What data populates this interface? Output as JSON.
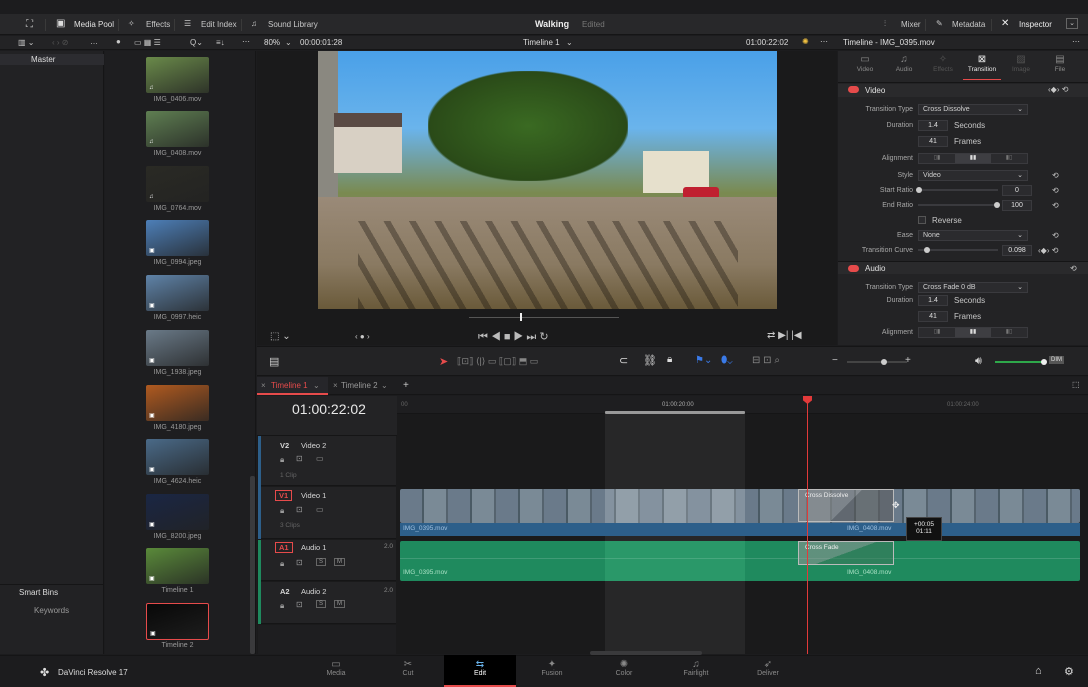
{
  "app": {
    "name": "DaVinci Resolve 17",
    "project": "Walking",
    "project_state": "Edited"
  },
  "toolbar": {
    "media_pool": "Media Pool",
    "effects": "Effects",
    "edit_index": "Edit Index",
    "sound_library": "Sound Library",
    "mixer": "Mixer",
    "metadata": "Metadata",
    "inspector": "Inspector"
  },
  "viewer": {
    "zoom": "80%",
    "source_tc": "00:00:01:28",
    "timeline_name": "Timeline 1",
    "record_tc": "01:00:22:02",
    "clip_title": "Timeline - IMG_0395.mov"
  },
  "bins": {
    "master": "Master",
    "smart_bins": "Smart Bins",
    "keywords": "Keywords"
  },
  "media": [
    {
      "name": "IMG_0406.mov",
      "color": "#6a8a4a"
    },
    {
      "name": "IMG_0408.mov",
      "color": "#5f7f52"
    },
    {
      "name": "IMG_0764.mov",
      "color": "#2a2a24"
    },
    {
      "name": "IMG_0994.jpeg",
      "color": "#4d7fb8"
    },
    {
      "name": "IMG_0997.heic",
      "color": "#5f83a8"
    },
    {
      "name": "IMG_1938.jpeg",
      "color": "#6a7a88"
    },
    {
      "name": "IMG_4180.jpeg",
      "color": "#b05a20"
    },
    {
      "name": "IMG_4624.heic",
      "color": "#4a6a88"
    },
    {
      "name": "IMG_8200.jpeg",
      "color": "#1a2644"
    },
    {
      "name": "Timeline 1",
      "color": "#5a8a3a"
    },
    {
      "name": "Timeline 2",
      "color": "#080808"
    }
  ],
  "inspector": {
    "tabs": [
      "Video",
      "Audio",
      "Effects",
      "Transition",
      "Image",
      "File"
    ],
    "active_tab": "Transition",
    "video_section": "Video",
    "transition_type_label": "Transition Type",
    "transition_type": "Cross Dissolve",
    "duration_label": "Duration",
    "duration_seconds": "1.4",
    "seconds_unit": "Seconds",
    "duration_frames": "41",
    "frames_unit": "Frames",
    "alignment_label": "Alignment",
    "style_label": "Style",
    "style": "Video",
    "start_ratio_label": "Start Ratio",
    "start_ratio": "0",
    "end_ratio_label": "End Ratio",
    "end_ratio": "100",
    "reverse_label": "Reverse",
    "ease_label": "Ease",
    "ease": "None",
    "curve_label": "Transition Curve",
    "curve": "0.098",
    "audio_section": "Audio",
    "audio_transition_type": "Cross Fade 0 dB",
    "audio_duration_seconds": "1.4",
    "audio_duration_frames": "41"
  },
  "timeline": {
    "tabs": [
      "Timeline 1",
      "Timeline 2"
    ],
    "timecode": "01:00:22:02",
    "ruler": [
      "00",
      "01:00:20:00",
      "01:00:24:00"
    ],
    "tracks": {
      "v2": {
        "id": "V2",
        "name": "Video 2",
        "clips": "1 Clip"
      },
      "v1": {
        "id": "V1",
        "name": "Video 1",
        "clips": "3 Clips"
      },
      "a1": {
        "id": "A1",
        "name": "Audio 1",
        "level": "2.0"
      },
      "a2": {
        "id": "A2",
        "name": "Audio 2",
        "level": "2.0"
      }
    },
    "clip_a": "IMG_0395.mov",
    "clip_b": "IMG_0408.mov",
    "video_transition": "Cross Dissolve",
    "audio_transition": "Cross Fade",
    "tooltip_offset": "+00:05",
    "tooltip_duration": "01:11",
    "dim_label": "DIM"
  },
  "pages": [
    "Media",
    "Cut",
    "Edit",
    "Fusion",
    "Color",
    "Fairlight",
    "Deliver"
  ],
  "active_page": "Edit",
  "colors": {
    "accent": "#e64b4b",
    "audio_clip": "#1f8a5e",
    "video_track": "#2d5f8a",
    "playhead": "#e23a3a"
  }
}
